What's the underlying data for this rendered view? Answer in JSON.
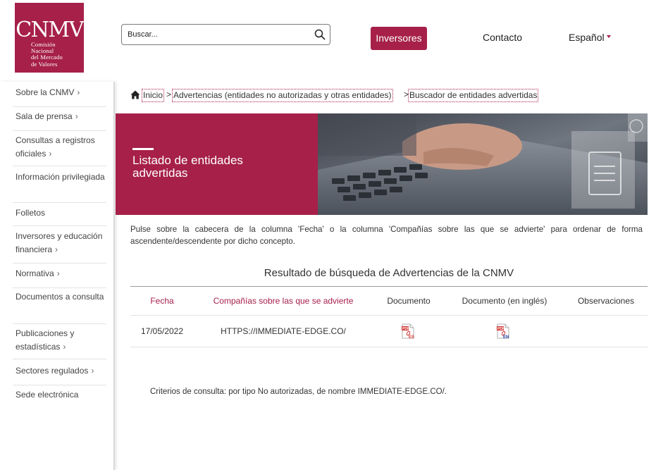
{
  "header": {
    "logo_main": "CNMV",
    "logo_lines": [
      "Comisión",
      "Nacional",
      "del Mercado",
      "de Valores"
    ],
    "search_placeholder": "Buscar...",
    "investors_label": "Inversores",
    "contact_label": "Contacto",
    "language_label": "Español"
  },
  "sidebar": {
    "items": [
      {
        "label": "Sobre la CNMV",
        "chevron": true
      },
      {
        "label": "Sala de prensa",
        "chevron": true
      },
      {
        "label": "Consultas a registros oficiales",
        "chevron": true
      },
      {
        "label": "Información privilegiada",
        "chevron": false
      },
      {
        "label": "Folletos",
        "chevron": false
      },
      {
        "label": "Inversores y educación financiera",
        "chevron": true
      },
      {
        "label": "Normativa",
        "chevron": true
      },
      {
        "label": "Documentos a consulta",
        "chevron": false
      },
      {
        "label": "Publicaciones y estadísticas",
        "chevron": true
      },
      {
        "label": "Sectores regulados",
        "chevron": true
      },
      {
        "label": "Sede electrónica",
        "chevron": false
      }
    ]
  },
  "breadcrumb": {
    "items": [
      "Inicio",
      "Advertencias (entidades no autorizadas y otras entidades)",
      "Buscador de entidades advertidas"
    ],
    "separator": ">"
  },
  "banner": {
    "title": "Listado de entidades advertidas"
  },
  "intro": {
    "text": "Pulse sobre la cabecera de la columna 'Fecha' o la columna 'Compañías sobre las que se advierte' para ordenar de forma ascendente/descendente por dicho concepto."
  },
  "results": {
    "title": "Resultado de búsqueda de Advertencias de la CNMV",
    "columns": [
      "Fecha",
      "Compañías sobre las que se advierte",
      "Documento",
      "Documento (en inglés)",
      "Observaciones"
    ],
    "rows": [
      {
        "fecha": "17/05/2022",
        "company": "HTTPS://IMMEDIATE-EDGE.CO/",
        "doc_es_label": "ES",
        "doc_en_label": "EN",
        "observaciones": ""
      }
    ],
    "criteria": "Criterios de consulta: por tipo No autorizadas, de nombre IMMEDIATE-EDGE.CO/."
  },
  "colors": {
    "brand": "#a6204a",
    "pdf_red": "#d0312d",
    "en_blue": "#1f3c9e"
  }
}
